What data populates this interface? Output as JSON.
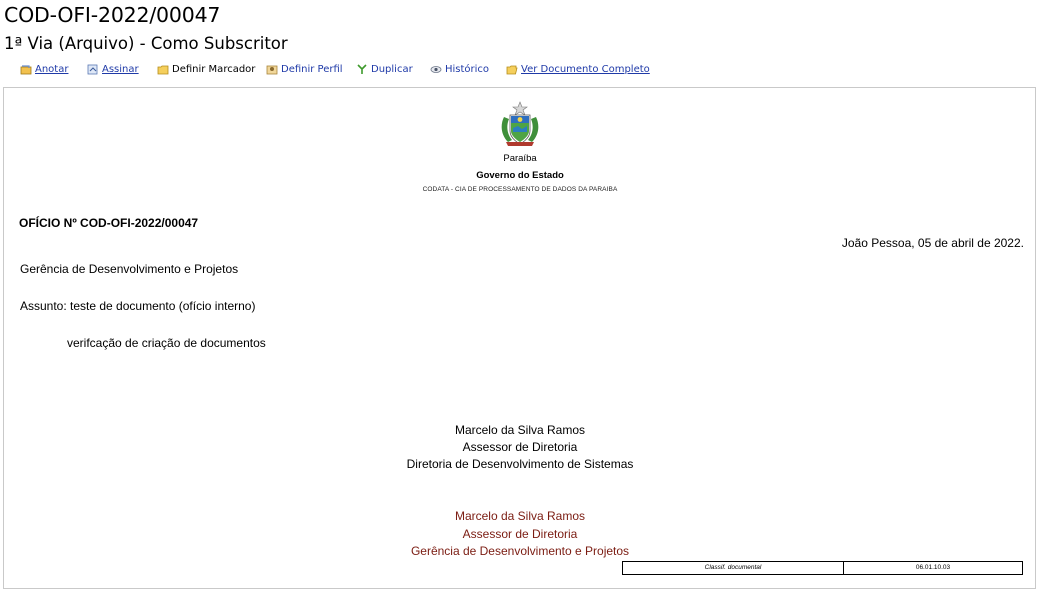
{
  "document": {
    "id": "COD-OFI-2022/00047",
    "subtitle": "1ª Via (Arquivo) - Como Subscritor"
  },
  "toolbar": {
    "items": [
      {
        "label": "Anotar",
        "icon": "annotate-icon"
      },
      {
        "label": "Assinar",
        "icon": "sign-icon"
      },
      {
        "label": "Definir Marcador",
        "icon": "bookmark-folder-icon"
      },
      {
        "label": "Definir Perfil",
        "icon": "profile-icon"
      },
      {
        "label": "Duplicar",
        "icon": "duplicate-icon"
      },
      {
        "label": "Histórico",
        "icon": "history-eye-icon"
      },
      {
        "label": "Ver Documento Completo",
        "icon": "folder-open-icon"
      }
    ]
  },
  "letterhead": {
    "state": "Paraíba",
    "government": "Governo do Estado",
    "organization": "CODATA - CIA DE PROCESSAMENTO DE DADOS DA PARAIBA"
  },
  "letter": {
    "number": "OFÍCIO Nº COD-OFI-2022/00047",
    "date": "João Pessoa, 05 de abril de 2022.",
    "recipient": "Gerência de Desenvolvimento e Projetos",
    "subject": "Assunto: teste de documento (ofício interno)",
    "body": "verifcação de criação de documentos"
  },
  "signatures": [
    {
      "name": "Marcelo da Silva Ramos",
      "role": "Assessor de Diretoria",
      "unit": "Diretoria de Desenvolvimento de Sistemas",
      "color": "#000000"
    },
    {
      "name": "Marcelo da Silva Ramos",
      "role": "Assessor de Diretoria",
      "unit": "Gerência de Desenvolvimento e Projetos",
      "color": "#7b1c12"
    }
  ],
  "classification": {
    "label": "Classif. documental",
    "value": "06.01.10.03"
  }
}
